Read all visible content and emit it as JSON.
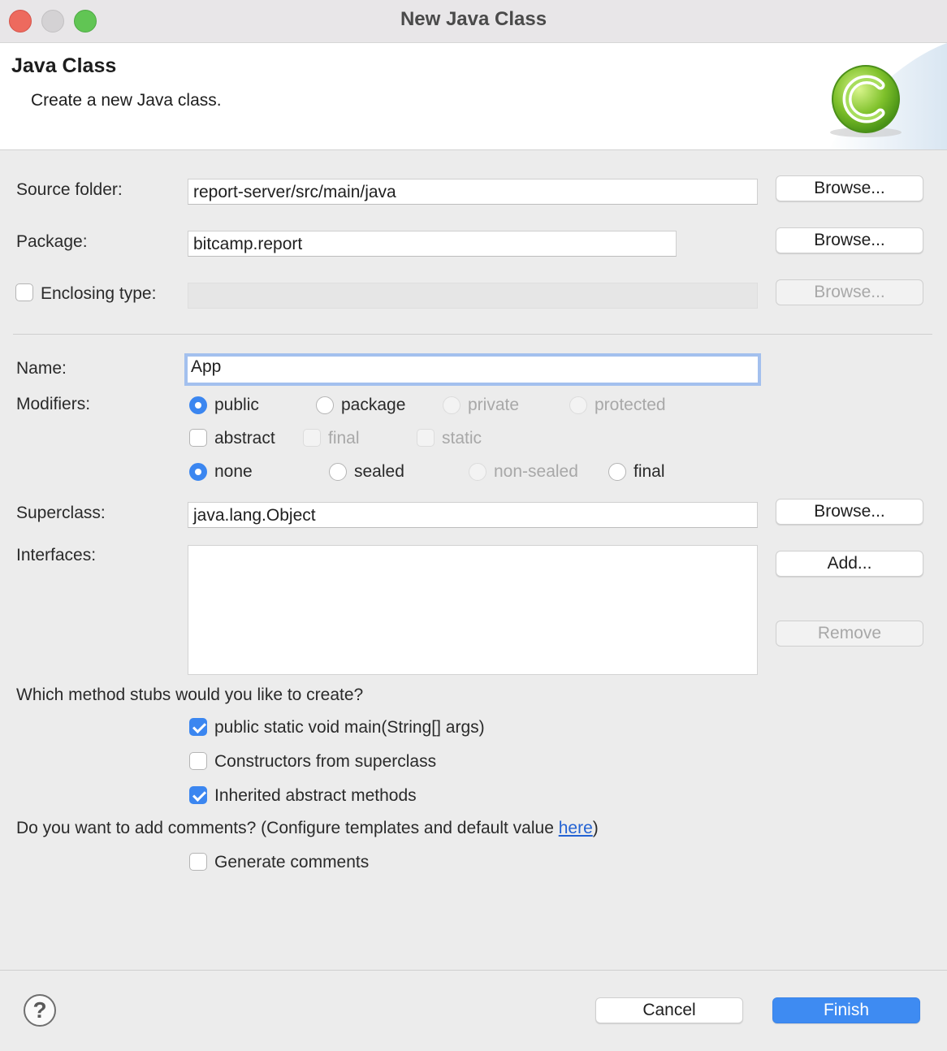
{
  "window": {
    "title": "New Java Class"
  },
  "header": {
    "title": "Java Class",
    "description": "Create a new Java class.",
    "icon": "java-class-wizard-icon"
  },
  "source_folder": {
    "label": "Source folder:",
    "value": "report-server/src/main/java",
    "browse": "Browse..."
  },
  "package": {
    "label": "Package:",
    "value": "bitcamp.report",
    "browse": "Browse..."
  },
  "enclosing": {
    "label": "Enclosing type:",
    "value": "",
    "browse": "Browse...",
    "checked": false
  },
  "name": {
    "label": "Name:",
    "value": "App"
  },
  "modifiers": {
    "label": "Modifiers:",
    "access": [
      "public",
      "package",
      "private",
      "protected"
    ],
    "access_selected": "public",
    "flags": [
      "abstract",
      "final",
      "static"
    ],
    "sealing": [
      "none",
      "sealed",
      "non-sealed",
      "final"
    ],
    "sealing_selected": "none"
  },
  "superclass": {
    "label": "Superclass:",
    "value": "java.lang.Object",
    "browse": "Browse..."
  },
  "interfaces": {
    "label": "Interfaces:",
    "add": "Add...",
    "remove": "Remove",
    "items": []
  },
  "stubs": {
    "question": "Which method stubs would you like to create?",
    "options": [
      {
        "label": "public static void main(String[] args)",
        "checked": true
      },
      {
        "label": "Constructors from superclass",
        "checked": false
      },
      {
        "label": "Inherited abstract methods",
        "checked": true
      }
    ]
  },
  "comments": {
    "question_prefix": "Do you want to add comments? (Configure templates and default value ",
    "link": "here",
    "question_suffix": ")",
    "option": "Generate comments",
    "checked": false
  },
  "footer": {
    "cancel": "Cancel",
    "finish": "Finish",
    "help": "?"
  },
  "colors": {
    "accent": "#3b86f0",
    "primary_button": "#3e8bf2",
    "link": "#2463d3"
  }
}
